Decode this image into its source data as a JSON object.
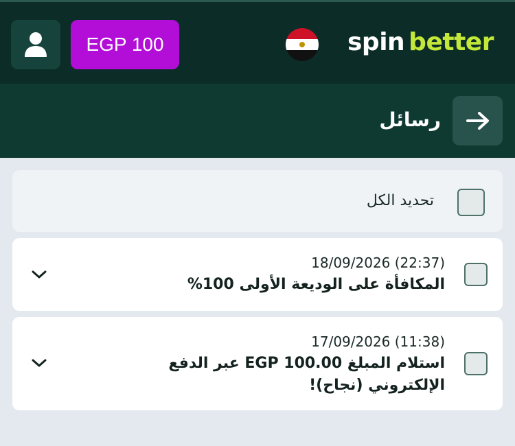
{
  "header": {
    "balance": "EGP 100",
    "logo_part1": "spin",
    "logo_part2": "better"
  },
  "page": {
    "title": "رسائل"
  },
  "select_all": {
    "label": "تحديد الكل"
  },
  "messages": [
    {
      "date": "18/09/2026 (22:37)",
      "text": "المكافأة على الوديعة الأولى 100%"
    },
    {
      "date": "17/09/2026 (11:38)",
      "text": "استلام المبلغ EGP 100.00 عبر الدفع الإلكتروني (نجاح)!"
    }
  ],
  "colors": {
    "header_bg": "#0c2c28",
    "subheader_bg": "#0f3a32",
    "balance_bg": "#b20ed8",
    "logo_accent": "#c3e83a"
  },
  "icons": {
    "user": "user-icon",
    "flag": "egypt-flag-icon",
    "back": "arrow-right-icon",
    "expand": "chevron-down-icon"
  }
}
